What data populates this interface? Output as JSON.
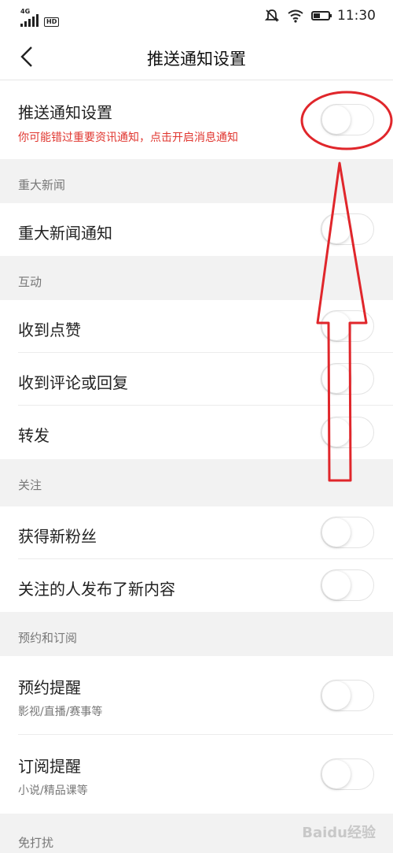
{
  "status": {
    "network": "4G",
    "hd": "HD",
    "time": "11:30"
  },
  "header": {
    "title": "推送通知设置"
  },
  "master": {
    "label": "推送通知设置",
    "warning": "你可能错过重要资讯通知，点击开启消息通知",
    "enabled": false
  },
  "sections": [
    {
      "title": "重大新闻",
      "items": [
        {
          "label": "重大新闻通知",
          "enabled": false
        }
      ]
    },
    {
      "title": "互动",
      "items": [
        {
          "label": "收到点赞",
          "enabled": false
        },
        {
          "label": "收到评论或回复",
          "enabled": false
        },
        {
          "label": "转发",
          "enabled": false
        }
      ]
    },
    {
      "title": "关注",
      "items": [
        {
          "label": "获得新粉丝",
          "enabled": false
        },
        {
          "label": "关注的人发布了新内容",
          "enabled": false
        }
      ]
    },
    {
      "title": "预约和订阅",
      "items": [
        {
          "label": "预约提醒",
          "sub": "影视/直播/赛事等",
          "enabled": false
        },
        {
          "label": "订阅提醒",
          "sub": "小说/精品课等",
          "enabled": false
        }
      ]
    },
    {
      "title": "免打扰"
    }
  ],
  "watermark": "Baidu经验",
  "colors": {
    "annotation": "#e0262b",
    "warning": "#e0362f"
  }
}
